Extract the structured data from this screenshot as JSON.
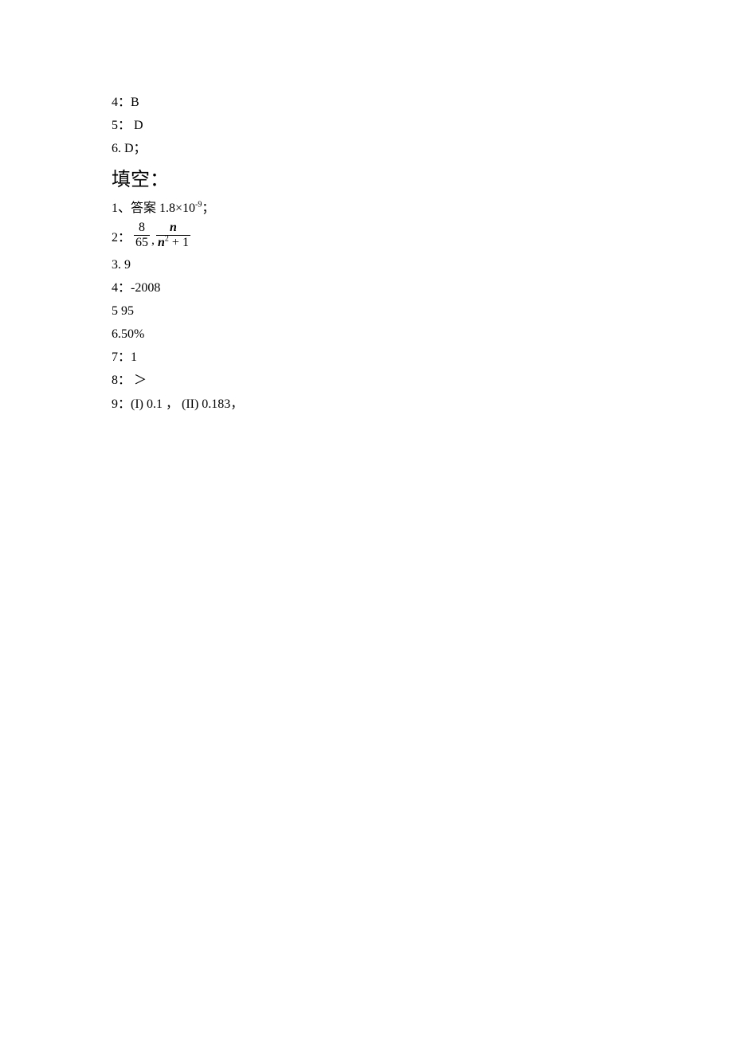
{
  "mc": {
    "q4": "4：B",
    "q5": "5： D",
    "q6": "6. D；"
  },
  "heading": "填空：",
  "fill": {
    "q1": "1、答案 1.8×10",
    "q1_exp": "-9",
    "q1_suffix": "；",
    "q2_prefix": "2：",
    "q2_frac1_num": "8",
    "q2_frac1_den": "65",
    "q2_sep": ",",
    "q2_frac2_num": "n",
    "q2_frac2_den_n": "n",
    "q2_frac2_den_exp": "2",
    "q2_frac2_den_plus": " + 1",
    "q3": "3. 9",
    "q4": "4：-2008",
    "q5": "5 95",
    "q6": "6.50%",
    "q7": "7：1",
    "q8": "8：  ＞",
    "q9": "9：(I) 0.1    ，  (II) 0.183，"
  }
}
